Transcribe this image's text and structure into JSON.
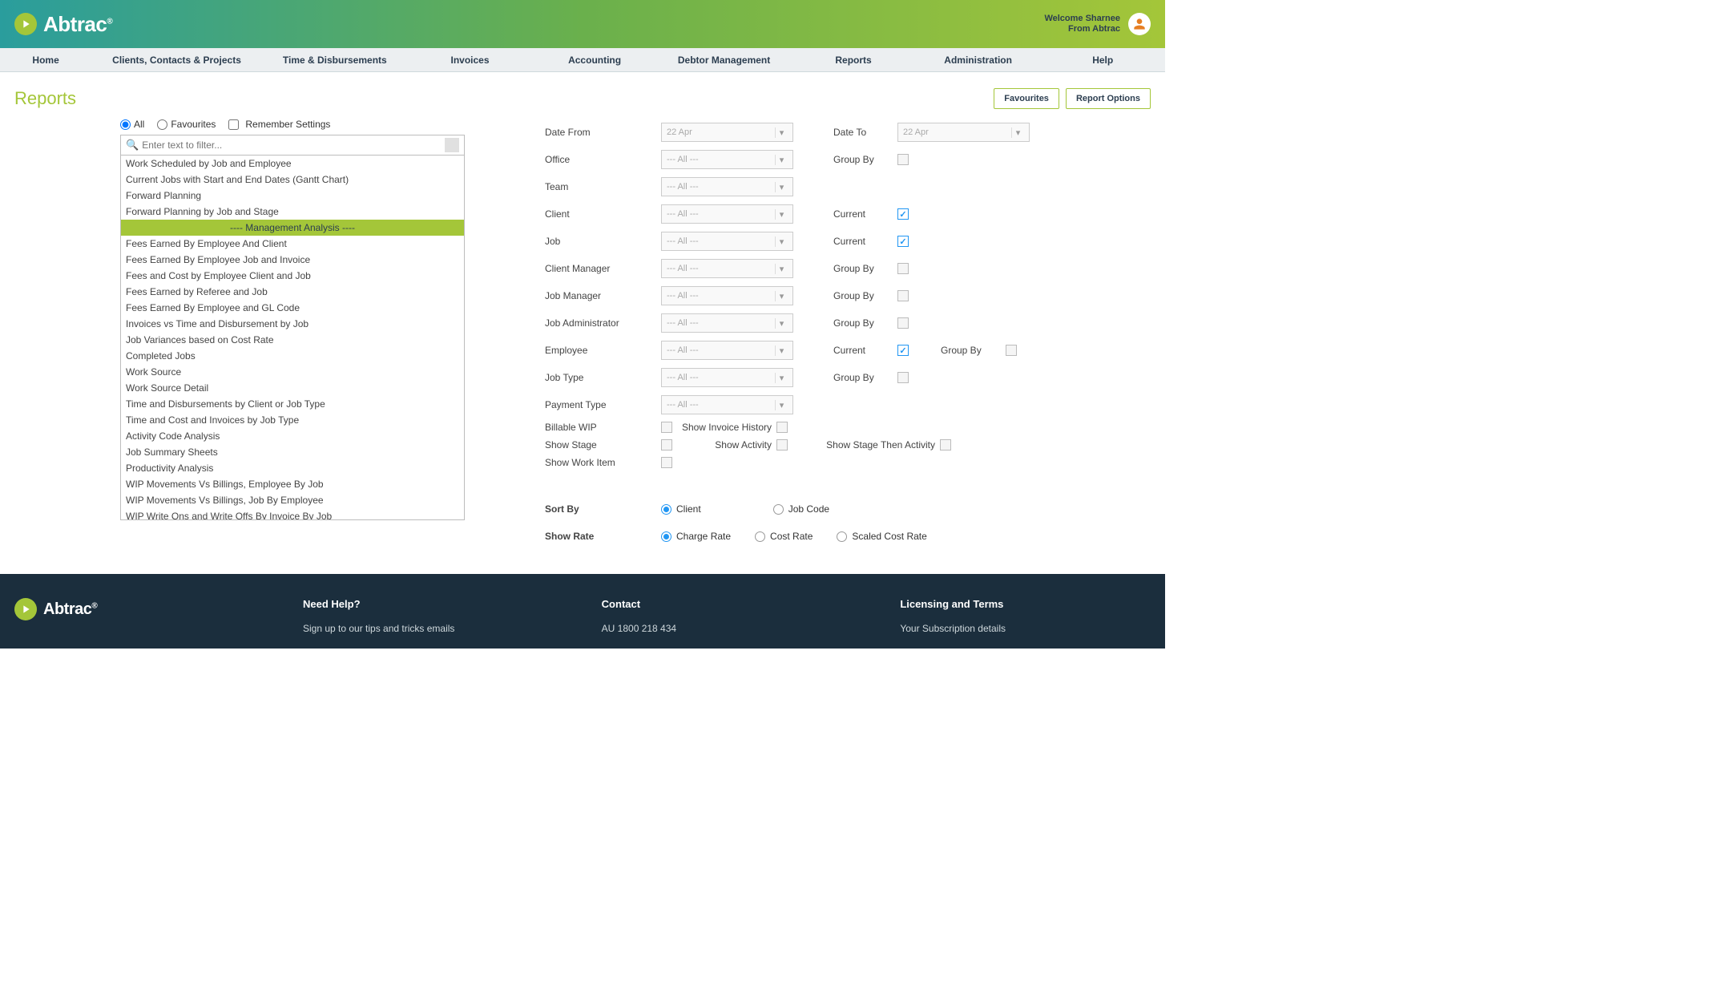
{
  "header": {
    "brand": "Abtrac",
    "reg": "®",
    "welcome_line1": "Welcome Sharnee",
    "welcome_line2": "From Abtrac"
  },
  "nav": [
    "Home",
    "Clients, Contacts & Projects",
    "Time & Disbursements",
    "Invoices",
    "Accounting",
    "Debtor Management",
    "Reports",
    "Administration",
    "Help"
  ],
  "page": {
    "title": "Reports",
    "btn_fav": "Favourites",
    "btn_opts": "Report Options"
  },
  "filters": {
    "all": "All",
    "fav": "Favourites",
    "remember": "Remember Settings"
  },
  "search_placeholder": "Enter text to filter...",
  "report_list": [
    {
      "t": "item",
      "label": "Work Scheduled by Job and Employee"
    },
    {
      "t": "item",
      "label": "Current Jobs with Start and End Dates (Gantt Chart)"
    },
    {
      "t": "item",
      "label": "Forward Planning"
    },
    {
      "t": "item",
      "label": "Forward Planning by Job and Stage"
    },
    {
      "t": "header",
      "label": "---- Management Analysis ----"
    },
    {
      "t": "item",
      "label": "Fees Earned By Employee And Client"
    },
    {
      "t": "item",
      "label": "Fees Earned By Employee Job and Invoice"
    },
    {
      "t": "item",
      "label": "Fees and Cost by Employee Client and Job"
    },
    {
      "t": "item",
      "label": "Fees Earned by Referee and Job"
    },
    {
      "t": "item",
      "label": "Fees Earned By Employee and GL Code"
    },
    {
      "t": "item",
      "label": "Invoices vs Time and Disbursement by Job"
    },
    {
      "t": "item",
      "label": "Job Variances based on Cost Rate"
    },
    {
      "t": "item",
      "label": "Completed Jobs"
    },
    {
      "t": "item",
      "label": "Work Source"
    },
    {
      "t": "item",
      "label": "Work Source Detail"
    },
    {
      "t": "item",
      "label": "Time and Disbursements by Client or Job Type"
    },
    {
      "t": "item",
      "label": "Time and Cost and Invoices by Job Type"
    },
    {
      "t": "item",
      "label": "Activity Code Analysis"
    },
    {
      "t": "item",
      "label": "Job Summary Sheets"
    },
    {
      "t": "item",
      "label": "Productivity Analysis"
    },
    {
      "t": "item",
      "label": "WIP Movements Vs Billings, Employee By Job"
    },
    {
      "t": "item",
      "label": "WIP Movements Vs Billings, Job By Employee"
    },
    {
      "t": "item",
      "label": "WIP Write Ons and Write Offs By Invoice By Job"
    }
  ],
  "form": {
    "date_from": {
      "label": "Date From",
      "value": "22 Apr"
    },
    "date_to": {
      "label": "Date To",
      "value": "22 Apr"
    },
    "office": {
      "label": "Office",
      "value": "--- All ---",
      "side": "Group By",
      "checked": false
    },
    "team": {
      "label": "Team",
      "value": "--- All ---"
    },
    "client": {
      "label": "Client",
      "value": "--- All ---",
      "side": "Current",
      "checked": true
    },
    "job": {
      "label": "Job",
      "value": "--- All ---",
      "side": "Current",
      "checked": true
    },
    "client_mgr": {
      "label": "Client Manager",
      "value": "--- All ---",
      "side": "Group By",
      "checked": false
    },
    "job_mgr": {
      "label": "Job Manager",
      "value": "--- All ---",
      "side": "Group By",
      "checked": false
    },
    "job_admin": {
      "label": "Job Administrator",
      "value": "--- All ---",
      "side": "Group By",
      "checked": false
    },
    "employee": {
      "label": "Employee",
      "value": "--- All ---",
      "side": "Current",
      "checked": true,
      "side2": "Group By",
      "checked2": false
    },
    "job_type": {
      "label": "Job Type",
      "value": "--- All ---",
      "side": "Group By",
      "checked": false
    },
    "payment_type": {
      "label": "Payment Type",
      "value": "--- All ---"
    },
    "billable_wip": "Billable WIP",
    "show_invoice_hist": "Show Invoice History",
    "show_stage": "Show Stage",
    "show_activity": "Show Activity",
    "show_stage_then": "Show Stage Then Activity",
    "show_work_item": "Show Work Item",
    "sort_by": "Sort By",
    "sort_client": "Client",
    "sort_jobcode": "Job Code",
    "show_rate": "Show Rate",
    "rate_charge": "Charge Rate",
    "rate_cost": "Cost Rate",
    "rate_scaled": "Scaled Cost Rate"
  },
  "footer": {
    "need_help": "Need Help?",
    "tips": "Sign up to our tips and tricks emails",
    "contact": "Contact",
    "au_phone": "AU 1800 218 434",
    "licensing": "Licensing and Terms",
    "subscription": "Your Subscription details"
  }
}
